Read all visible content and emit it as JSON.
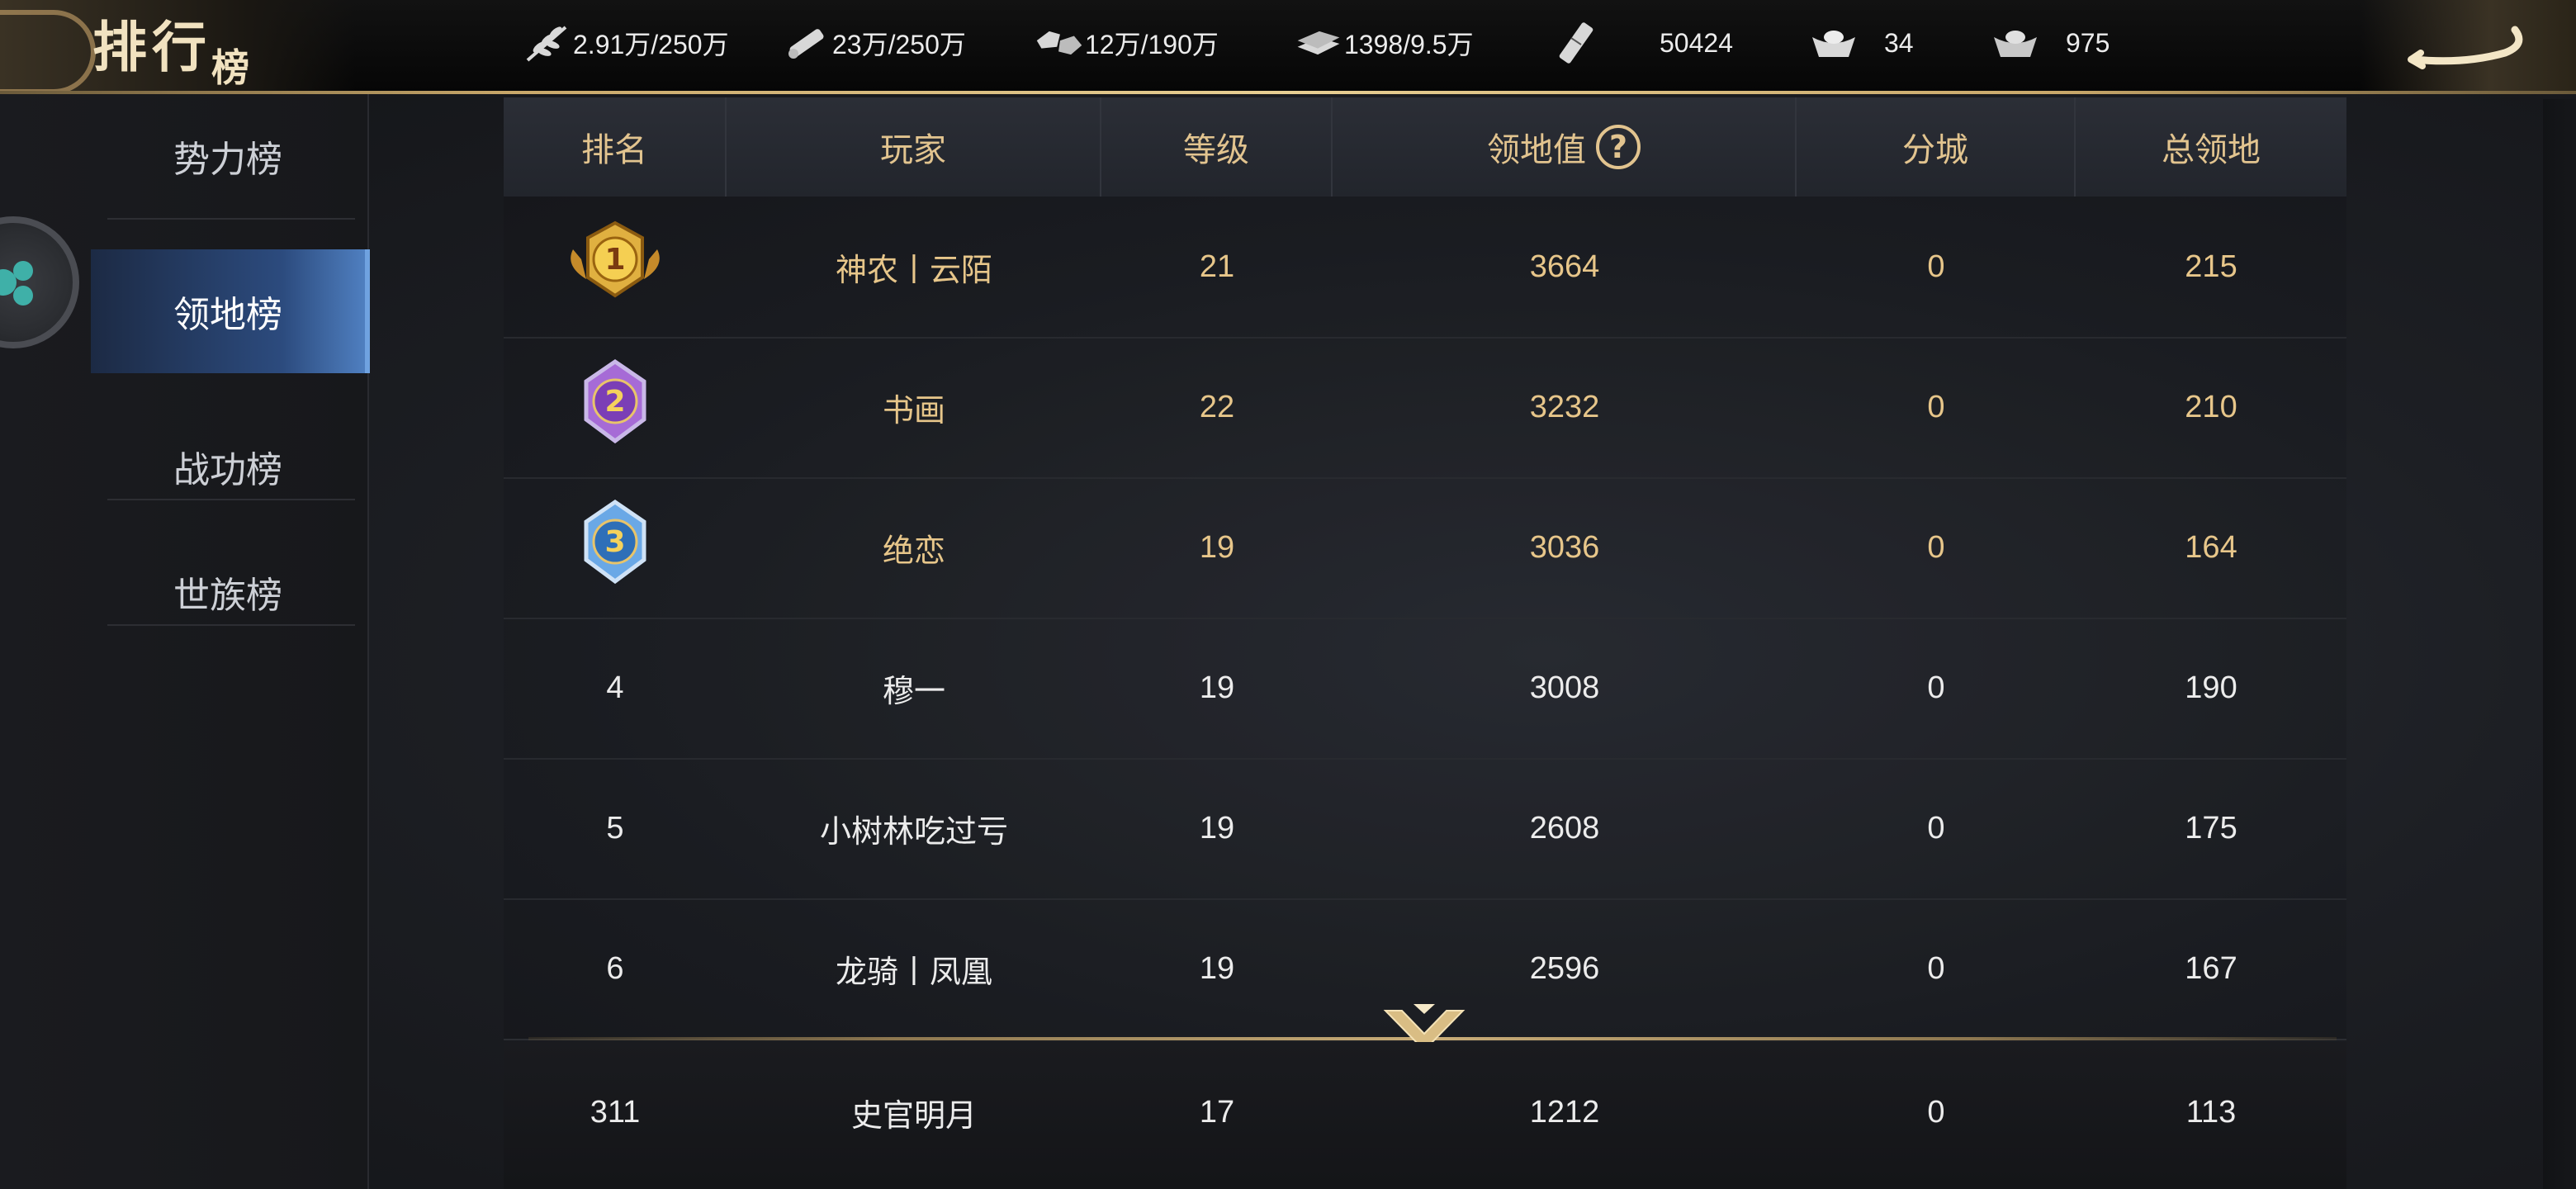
{
  "header": {
    "title_big": "排行",
    "title_small": "榜"
  },
  "resources": [
    {
      "icon": "grain-icon",
      "value": "2.91万/250万"
    },
    {
      "icon": "wood-icon",
      "value": "23万/250万"
    },
    {
      "icon": "stone-icon",
      "value": "12万/190万"
    },
    {
      "icon": "iron-icon",
      "value": "1398/9.5万"
    },
    {
      "icon": "decree-icon",
      "value": "50424"
    },
    {
      "icon": "gold-ingot-icon",
      "value": "34"
    },
    {
      "icon": "silver-ingot-icon",
      "value": "975"
    }
  ],
  "sidebar": {
    "tabs": [
      {
        "label": "势力榜",
        "active": false
      },
      {
        "label": "领地榜",
        "active": true
      },
      {
        "label": "战功榜",
        "active": false
      },
      {
        "label": "世族榜",
        "active": false
      }
    ]
  },
  "table": {
    "columns": [
      "排名",
      "玩家",
      "等级",
      "领地值",
      "分城",
      "总领地"
    ],
    "rows": [
      {
        "rank": "1",
        "player": "神农丨云陌",
        "level": "21",
        "territory_value": "3664",
        "sub_city": "0",
        "total_territory": "215"
      },
      {
        "rank": "2",
        "player": "书画",
        "level": "22",
        "territory_value": "3232",
        "sub_city": "0",
        "total_territory": "210"
      },
      {
        "rank": "3",
        "player": "绝恋",
        "level": "19",
        "territory_value": "3036",
        "sub_city": "0",
        "total_territory": "164"
      },
      {
        "rank": "4",
        "player": "穆一",
        "level": "19",
        "territory_value": "3008",
        "sub_city": "0",
        "total_territory": "190"
      },
      {
        "rank": "5",
        "player": "小树林吃过亏",
        "level": "19",
        "territory_value": "2608",
        "sub_city": "0",
        "total_territory": "175"
      },
      {
        "rank": "6",
        "player": "龙骑丨凤凰",
        "level": "19",
        "territory_value": "2596",
        "sub_city": "0",
        "total_territory": "167"
      }
    ],
    "self_row": {
      "rank": "311",
      "player": "史官明月",
      "level": "17",
      "territory_value": "1212",
      "sub_city": "0",
      "total_territory": "113"
    }
  },
  "colors": {
    "gold_text": "#e7c68a",
    "header_text": "#e2c48f",
    "active_tab": "#2c4b7e",
    "medal_gold": "#e0b040",
    "medal_purple": "#8e4fc4",
    "medal_blue": "#4a90d8"
  }
}
